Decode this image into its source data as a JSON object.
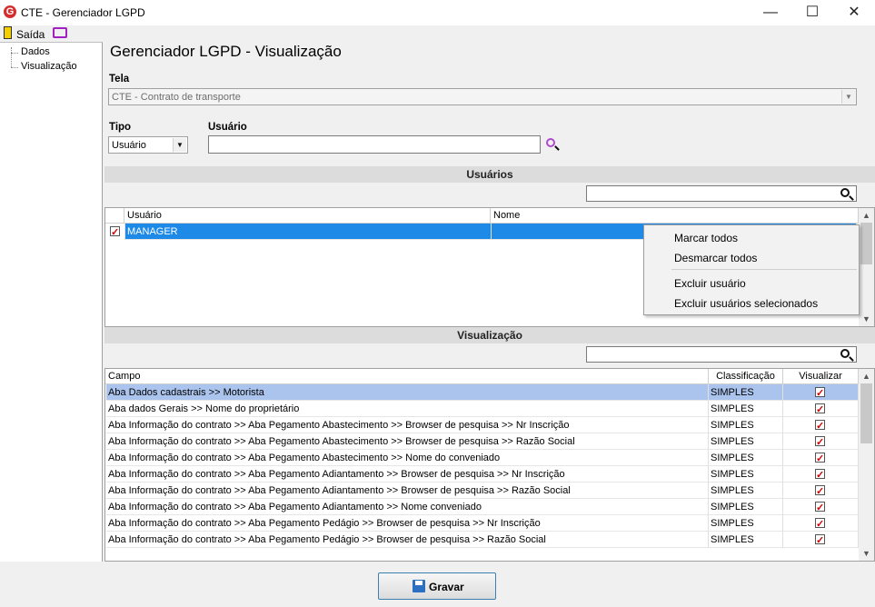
{
  "window": {
    "title": "CTE - Gerenciador LGPD",
    "logo_letter": "G",
    "minimize": "—",
    "maximize": "☐",
    "close": "✕"
  },
  "toolbar": {
    "exit_label": "Saída"
  },
  "tree": {
    "items": [
      "Dados",
      "Visualização"
    ]
  },
  "page": {
    "title": "Gerenciador LGPD - Visualização"
  },
  "form": {
    "tela_label": "Tela",
    "tela_value": "CTE - Contrato de transporte",
    "tipo_label": "Tipo",
    "tipo_value": "Usuário",
    "usuario_label": "Usuário",
    "usuario_value": ""
  },
  "users_section": {
    "title": "Usuários",
    "search_value": "",
    "columns": [
      "Usuário",
      "Nome"
    ],
    "rows": [
      {
        "usuario": "MANAGER",
        "nome": "",
        "checked": true
      }
    ]
  },
  "context_menu": {
    "items": [
      "Marcar todos",
      "Desmarcar todos",
      "Excluir usuário",
      "Excluir usuários selecionados"
    ]
  },
  "view_section": {
    "title": "Visualização",
    "search_value": "",
    "columns": [
      "Campo",
      "Classificação",
      "Visualizar"
    ],
    "rows": [
      {
        "campo": "Aba Dados cadastrais >> Motorista",
        "classificacao": "SIMPLES",
        "visualizar": true
      },
      {
        "campo": "Aba dados Gerais >> Nome do proprietário",
        "classificacao": "SIMPLES",
        "visualizar": true
      },
      {
        "campo": "Aba Informação do contrato >> Aba Pegamento Abastecimento >> Browser de pesquisa >> Nr Inscrição",
        "classificacao": "SIMPLES",
        "visualizar": true
      },
      {
        "campo": "Aba Informação do contrato >> Aba Pegamento Abastecimento >> Browser de pesquisa >> Razão Social",
        "classificacao": "SIMPLES",
        "visualizar": true
      },
      {
        "campo": "Aba Informação do contrato >> Aba Pegamento Abastecimento >> Nome do conveniado",
        "classificacao": "SIMPLES",
        "visualizar": true
      },
      {
        "campo": "Aba Informação do contrato >> Aba Pegamento Adiantamento >> Browser de pesquisa >> Nr Inscrição",
        "classificacao": "SIMPLES",
        "visualizar": true
      },
      {
        "campo": "Aba Informação do contrato >> Aba Pegamento Adiantamento >> Browser de pesquisa >> Razão Social",
        "classificacao": "SIMPLES",
        "visualizar": true
      },
      {
        "campo": "Aba Informação do contrato >> Aba Pegamento Adiantamento >> Nome conveniado",
        "classificacao": "SIMPLES",
        "visualizar": true
      },
      {
        "campo": "Aba Informação do contrato >> Aba Pegamento Pedágio >> Browser de pesquisa >> Nr Inscrição",
        "classificacao": "SIMPLES",
        "visualizar": true
      },
      {
        "campo": "Aba Informação do contrato >> Aba Pegamento Pedágio >> Browser de pesquisa >> Razão Social",
        "classificacao": "SIMPLES",
        "visualizar": true
      }
    ]
  },
  "footer": {
    "save_label": "Gravar"
  },
  "colors": {
    "selected_row": "#aac4ee",
    "selected_user_row": "#1e8ae8",
    "section_bar": "#dcdcdc",
    "check_mark": "#d00000"
  }
}
